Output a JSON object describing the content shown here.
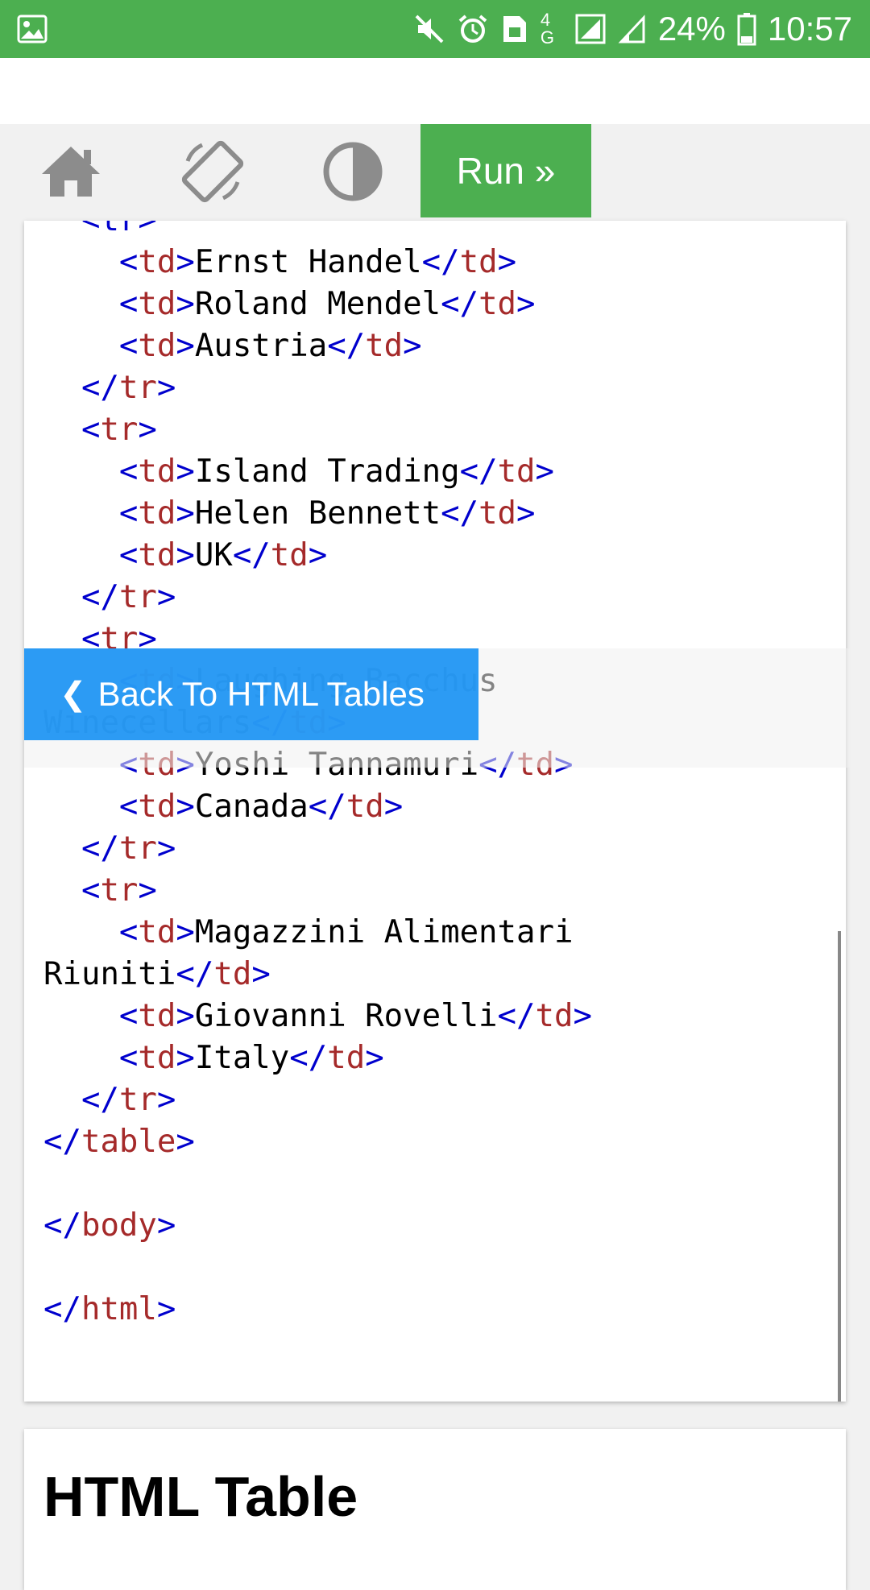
{
  "status_bar": {
    "battery_percent": "24%",
    "time": "10:57",
    "network": "4G",
    "icons": [
      "image-icon",
      "mute-icon",
      "alarm-icon",
      "sim-icon",
      "signal-icon",
      "battery-icon"
    ]
  },
  "toolbar": {
    "home_icon": "home-icon",
    "rotate_icon": "rotate-icon",
    "theme_icon": "contrast-icon",
    "run_label": "Run »"
  },
  "code_lines": [
    [
      [
        "  ",
        ""
      ],
      [
        "<tr>",
        "b"
      ]
    ],
    [
      [
        "    ",
        ""
      ],
      [
        "<",
        "b"
      ],
      [
        "td",
        "r"
      ],
      [
        ">",
        "b"
      ],
      [
        "Ernst Handel",
        ""
      ],
      [
        "</",
        "b"
      ],
      [
        "td",
        "r"
      ],
      [
        ">",
        "b"
      ]
    ],
    [
      [
        "    ",
        ""
      ],
      [
        "<",
        "b"
      ],
      [
        "td",
        "r"
      ],
      [
        ">",
        "b"
      ],
      [
        "Roland Mendel",
        ""
      ],
      [
        "</",
        "b"
      ],
      [
        "td",
        "r"
      ],
      [
        ">",
        "b"
      ]
    ],
    [
      [
        "    ",
        ""
      ],
      [
        "<",
        "b"
      ],
      [
        "td",
        "r"
      ],
      [
        ">",
        "b"
      ],
      [
        "Austria",
        ""
      ],
      [
        "</",
        "b"
      ],
      [
        "td",
        "r"
      ],
      [
        ">",
        "b"
      ]
    ],
    [
      [
        "  ",
        ""
      ],
      [
        "</",
        "b"
      ],
      [
        "tr",
        "r"
      ],
      [
        ">",
        "b"
      ]
    ],
    [
      [
        "  ",
        ""
      ],
      [
        "<",
        "b"
      ],
      [
        "tr",
        "r"
      ],
      [
        ">",
        "b"
      ]
    ],
    [
      [
        "    ",
        ""
      ],
      [
        "<",
        "b"
      ],
      [
        "td",
        "r"
      ],
      [
        ">",
        "b"
      ],
      [
        "Island Trading",
        ""
      ],
      [
        "</",
        "b"
      ],
      [
        "td",
        "r"
      ],
      [
        ">",
        "b"
      ]
    ],
    [
      [
        "    ",
        ""
      ],
      [
        "<",
        "b"
      ],
      [
        "td",
        "r"
      ],
      [
        ">",
        "b"
      ],
      [
        "Helen Bennett",
        ""
      ],
      [
        "</",
        "b"
      ],
      [
        "td",
        "r"
      ],
      [
        ">",
        "b"
      ]
    ],
    [
      [
        "    ",
        ""
      ],
      [
        "<",
        "b"
      ],
      [
        "td",
        "r"
      ],
      [
        ">",
        "b"
      ],
      [
        "UK",
        ""
      ],
      [
        "</",
        "b"
      ],
      [
        "td",
        "r"
      ],
      [
        ">",
        "b"
      ]
    ],
    [
      [
        "  ",
        ""
      ],
      [
        "</",
        "b"
      ],
      [
        "tr",
        "r"
      ],
      [
        ">",
        "b"
      ]
    ],
    [
      [
        "  ",
        ""
      ],
      [
        "<",
        "b"
      ],
      [
        "tr",
        "r"
      ],
      [
        ">",
        "b"
      ]
    ],
    [
      [
        "    ",
        ""
      ],
      [
        "<",
        "b"
      ],
      [
        "td",
        "r"
      ],
      [
        ">",
        "b"
      ],
      [
        "Laughing Bacchus",
        ""
      ]
    ],
    [
      [
        "Winecellars",
        ""
      ],
      [
        "</",
        "b"
      ],
      [
        "td",
        "r"
      ],
      [
        ">",
        "b"
      ]
    ],
    [
      [
        "    ",
        ""
      ],
      [
        "<",
        "b"
      ],
      [
        "td",
        "r"
      ],
      [
        ">",
        "b"
      ],
      [
        "Yoshi Tannamuri",
        ""
      ],
      [
        "</",
        "b"
      ],
      [
        "td",
        "r"
      ],
      [
        ">",
        "b"
      ]
    ],
    [
      [
        "    ",
        ""
      ],
      [
        "<",
        "b"
      ],
      [
        "td",
        "r"
      ],
      [
        ">",
        "b"
      ],
      [
        "Canada",
        ""
      ],
      [
        "</",
        "b"
      ],
      [
        "td",
        "r"
      ],
      [
        ">",
        "b"
      ]
    ],
    [
      [
        "  ",
        ""
      ],
      [
        "</",
        "b"
      ],
      [
        "tr",
        "r"
      ],
      [
        ">",
        "b"
      ]
    ],
    [
      [
        "  ",
        ""
      ],
      [
        "<",
        "b"
      ],
      [
        "tr",
        "r"
      ],
      [
        ">",
        "b"
      ]
    ],
    [
      [
        "    ",
        ""
      ],
      [
        "<",
        "b"
      ],
      [
        "td",
        "r"
      ],
      [
        ">",
        "b"
      ],
      [
        "Magazzini Alimentari",
        ""
      ]
    ],
    [
      [
        "Riuniti",
        ""
      ],
      [
        "</",
        "b"
      ],
      [
        "td",
        "r"
      ],
      [
        ">",
        "b"
      ]
    ],
    [
      [
        "    ",
        ""
      ],
      [
        "<",
        "b"
      ],
      [
        "td",
        "r"
      ],
      [
        ">",
        "b"
      ],
      [
        "Giovanni Rovelli",
        ""
      ],
      [
        "</",
        "b"
      ],
      [
        "td",
        "r"
      ],
      [
        ">",
        "b"
      ]
    ],
    [
      [
        "    ",
        ""
      ],
      [
        "<",
        "b"
      ],
      [
        "td",
        "r"
      ],
      [
        ">",
        "b"
      ],
      [
        "Italy",
        ""
      ],
      [
        "</",
        "b"
      ],
      [
        "td",
        "r"
      ],
      [
        ">",
        "b"
      ]
    ],
    [
      [
        "  ",
        ""
      ],
      [
        "</",
        "b"
      ],
      [
        "tr",
        "r"
      ],
      [
        ">",
        "b"
      ]
    ],
    [
      [
        "</",
        "b"
      ],
      [
        "table",
        "r"
      ],
      [
        ">",
        "b"
      ]
    ],
    [
      [
        "",
        ""
      ]
    ],
    [
      [
        "</",
        "b"
      ],
      [
        "body",
        "r"
      ],
      [
        ">",
        "b"
      ]
    ],
    [
      [
        "",
        ""
      ]
    ],
    [
      [
        "</",
        "b"
      ],
      [
        "html",
        "r"
      ],
      [
        ">",
        "b"
      ]
    ]
  ],
  "back_button": {
    "label": "Back To HTML Tables"
  },
  "section": {
    "heading": "HTML Table"
  },
  "colors": {
    "green": "#4caf50",
    "blue": "#2196f3",
    "tag_bracket": "#0000cd",
    "tag_name": "#a52a2a"
  }
}
